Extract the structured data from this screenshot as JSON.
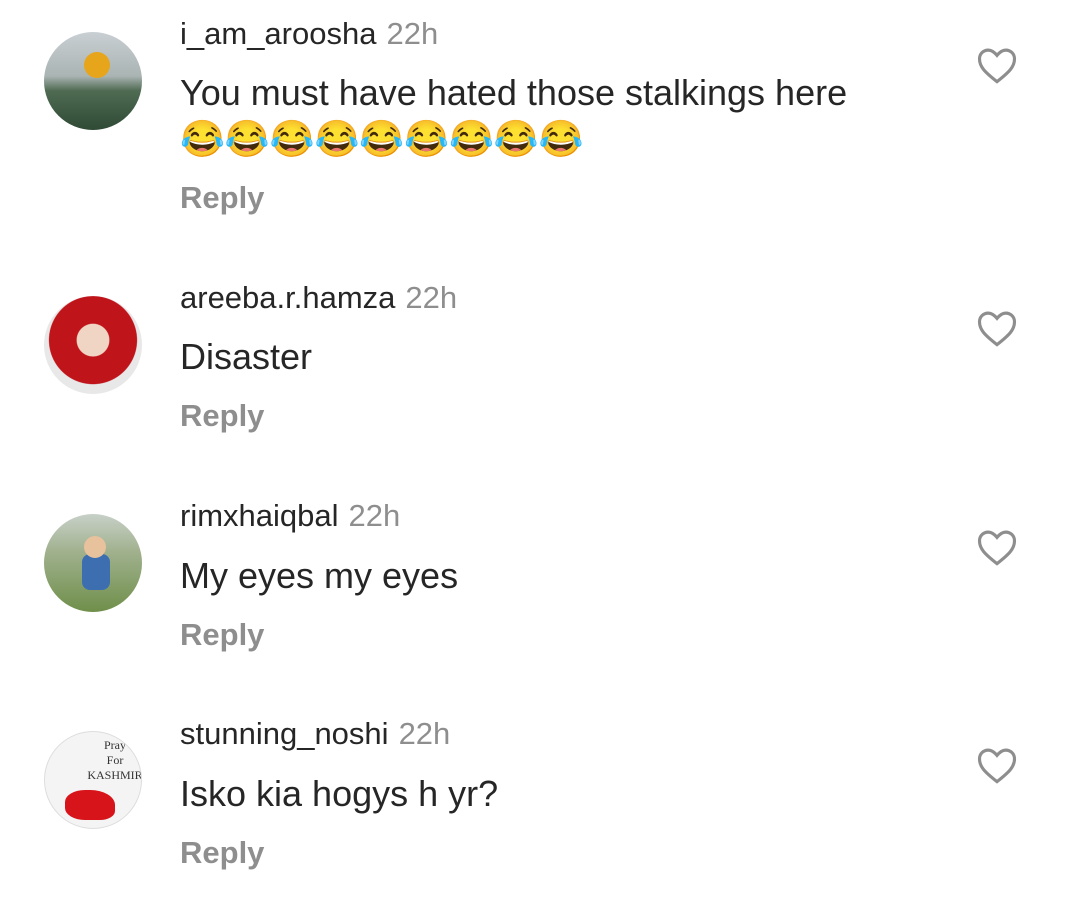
{
  "comments": [
    {
      "username": "i_am_aroosha",
      "time": "22h",
      "text": "You must have hated those stalkings here",
      "emoji": "😂😂😂😂😂😂😂😂😂",
      "reply": "Reply",
      "avatar": "sunflower"
    },
    {
      "username": "areeba.r.hamza",
      "time": "22h",
      "text": "Disaster",
      "reply": "Reply",
      "avatar": "baby-red-bow"
    },
    {
      "username": "rimxhaiqbal",
      "time": "22h",
      "text": "My eyes my eyes",
      "reply": "Reply",
      "avatar": "child-grass"
    },
    {
      "username": "stunning_noshi",
      "time": "22h",
      "text": "Isko kia hogys h yr?",
      "reply": "Reply",
      "avatar": "pray-for-kashmir",
      "avatar_text": "Pray For KASHMIR"
    }
  ]
}
